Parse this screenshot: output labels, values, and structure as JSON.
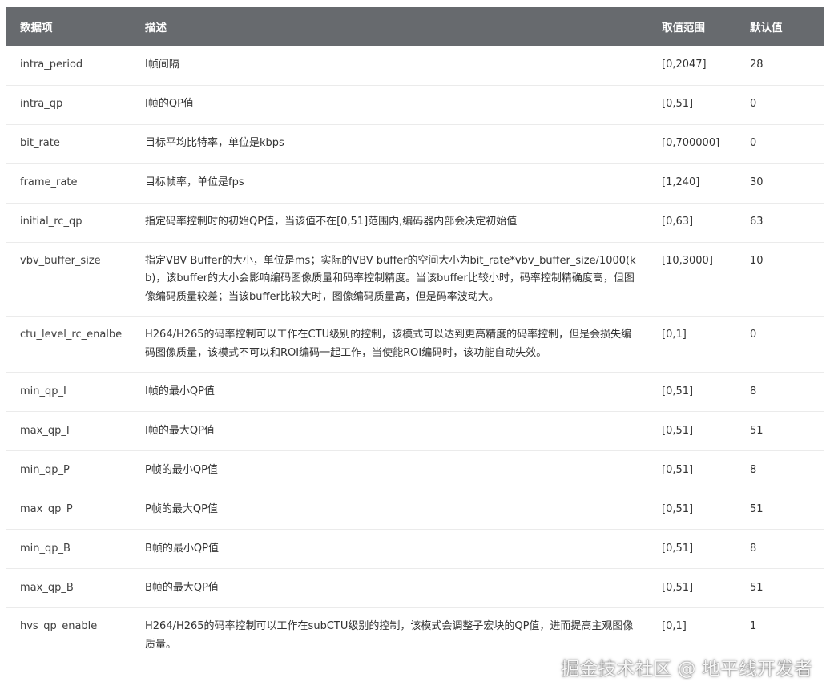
{
  "header": {
    "col_name": "数据项",
    "col_desc": "描述",
    "col_range": "取值范围",
    "col_default": "默认值"
  },
  "rows": [
    {
      "name": "intra_period",
      "desc": "I帧间隔",
      "range": "[0,2047]",
      "default": "28"
    },
    {
      "name": "intra_qp",
      "desc": "I帧的QP值",
      "range": "[0,51]",
      "default": "0"
    },
    {
      "name": "bit_rate",
      "desc": "目标平均比特率，单位是kbps",
      "range": "[0,700000]",
      "default": "0"
    },
    {
      "name": "frame_rate",
      "desc": "目标帧率，单位是fps",
      "range": "[1,240]",
      "default": "30"
    },
    {
      "name": "initial_rc_qp",
      "desc": "指定码率控制时的初始QP值，当该值不在[0,51]范围内,编码器内部会决定初始值",
      "range": "[0,63]",
      "default": "63"
    },
    {
      "name": "vbv_buffer_size",
      "desc": "指定VBV Buffer的大小，单位是ms；实际的VBV buffer的空间大小为bit_rate*vbv_buffer_size/1000(kb)，该buffer的大小会影响编码图像质量和码率控制精度。当该buffer比较小时，码率控制精确度高，但图像编码质量较差；当该buffer比较大时，图像编码质量高，但是码率波动大。",
      "range": "[10,3000]",
      "default": "10"
    },
    {
      "name": "ctu_level_rc_enalbe",
      "desc": "H264/H265的码率控制可以工作在CTU级别的控制，该模式可以达到更高精度的码率控制，但是会损失编码图像质量，该模式不可以和ROI编码一起工作，当使能ROI编码时，该功能自动失效。",
      "range": "[0,1]",
      "default": "0"
    },
    {
      "name": "min_qp_I",
      "desc": "I帧的最小QP值",
      "range": "[0,51]",
      "default": "8"
    },
    {
      "name": "max_qp_I",
      "desc": "I帧的最大QP值",
      "range": "[0,51]",
      "default": "51"
    },
    {
      "name": "min_qp_P",
      "desc": "P帧的最小QP值",
      "range": "[0,51]",
      "default": "8"
    },
    {
      "name": "max_qp_P",
      "desc": "P帧的最大QP值",
      "range": "[0,51]",
      "default": "51"
    },
    {
      "name": "min_qp_B",
      "desc": "B帧的最小QP值",
      "range": "[0,51]",
      "default": "8"
    },
    {
      "name": "max_qp_B",
      "desc": "B帧的最大QP值",
      "range": "[0,51]",
      "default": "51"
    },
    {
      "name": "hvs_qp_enable",
      "desc": "H264/H265的码率控制可以工作在subCTU级别的控制，该模式会调整子宏块的QP值，进而提高主观图像质量。",
      "range": "[0,1]",
      "default": "1"
    }
  ],
  "watermark": "掘金技术社区 @ 地平线开发者"
}
